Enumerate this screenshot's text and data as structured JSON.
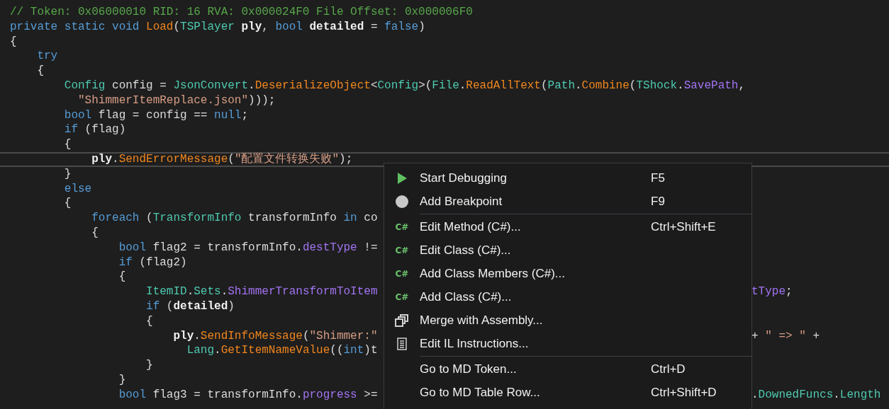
{
  "code": {
    "lines": [
      {
        "current": false,
        "tokens": [
          {
            "kind": "comment",
            "text": "// Token: 0x06000010 RID: 16 RVA: 0x000024F0 File Offset: 0x000006F0"
          }
        ]
      },
      {
        "current": false,
        "tokens": [
          {
            "kind": "keyword",
            "text": "private static void"
          },
          {
            "kind": "method",
            "text": " Load"
          },
          {
            "kind": "plain",
            "text": "("
          },
          {
            "kind": "type",
            "text": "TSPlayer"
          },
          {
            "kind": "param",
            "text": " ply"
          },
          {
            "kind": "plain",
            "text": ", "
          },
          {
            "kind": "keyword",
            "text": "bool"
          },
          {
            "kind": "param",
            "text": " detailed"
          },
          {
            "kind": "plain",
            "text": " = "
          },
          {
            "kind": "keyword",
            "text": "false"
          },
          {
            "kind": "plain",
            "text": ")"
          }
        ]
      },
      {
        "current": false,
        "tokens": [
          {
            "kind": "plain",
            "text": "{"
          }
        ]
      },
      {
        "current": false,
        "tokens": [
          {
            "kind": "keyword",
            "text": "    try"
          }
        ]
      },
      {
        "current": false,
        "tokens": [
          {
            "kind": "plain",
            "text": "    {"
          }
        ]
      },
      {
        "current": false,
        "tokens": [
          {
            "kind": "type",
            "text": "        Config"
          },
          {
            "kind": "plain",
            "text": " config = "
          },
          {
            "kind": "type",
            "text": "JsonConvert"
          },
          {
            "kind": "plain",
            "text": "."
          },
          {
            "kind": "method",
            "text": "DeserializeObject"
          },
          {
            "kind": "plain",
            "text": "<"
          },
          {
            "kind": "type",
            "text": "Config"
          },
          {
            "kind": "plain",
            "text": ">("
          },
          {
            "kind": "type",
            "text": "File"
          },
          {
            "kind": "plain",
            "text": "."
          },
          {
            "kind": "method",
            "text": "ReadAllText"
          },
          {
            "kind": "plain",
            "text": "("
          },
          {
            "kind": "type",
            "text": "Path"
          },
          {
            "kind": "plain",
            "text": "."
          },
          {
            "kind": "method",
            "text": "Combine"
          },
          {
            "kind": "plain",
            "text": "("
          },
          {
            "kind": "type",
            "text": "TShock"
          },
          {
            "kind": "plain",
            "text": "."
          },
          {
            "kind": "property",
            "text": "SavePath"
          },
          {
            "kind": "plain",
            "text": ","
          }
        ]
      },
      {
        "current": false,
        "tokens": [
          {
            "kind": "string",
            "text": "          \"ShimmerItemReplace.json\""
          },
          {
            "kind": "plain",
            "text": ")));"
          }
        ]
      },
      {
        "current": false,
        "tokens": [
          {
            "kind": "keyword",
            "text": "        bool"
          },
          {
            "kind": "plain",
            "text": " flag = config == "
          },
          {
            "kind": "keyword",
            "text": "null"
          },
          {
            "kind": "plain",
            "text": ";"
          }
        ]
      },
      {
        "current": false,
        "tokens": [
          {
            "kind": "keyword",
            "text": "        if"
          },
          {
            "kind": "plain",
            "text": " (flag)"
          }
        ]
      },
      {
        "current": false,
        "tokens": [
          {
            "kind": "plain",
            "text": "        {"
          }
        ]
      },
      {
        "current": true,
        "tokens": [
          {
            "kind": "param",
            "text": "            ply"
          },
          {
            "kind": "plain",
            "text": "."
          },
          {
            "kind": "method",
            "text": "SendErrorMessage"
          },
          {
            "kind": "plain",
            "text": "("
          },
          {
            "kind": "string",
            "text": "\"配置文件转换失败\""
          },
          {
            "kind": "plain",
            "text": ");"
          }
        ]
      },
      {
        "current": false,
        "tokens": [
          {
            "kind": "plain",
            "text": "        }"
          }
        ]
      },
      {
        "current": false,
        "tokens": [
          {
            "kind": "keyword",
            "text": "        else"
          }
        ]
      },
      {
        "current": false,
        "tokens": [
          {
            "kind": "plain",
            "text": "        {"
          }
        ]
      },
      {
        "current": false,
        "tokens": [
          {
            "kind": "keyword",
            "text": "            foreach"
          },
          {
            "kind": "plain",
            "text": " ("
          },
          {
            "kind": "type",
            "text": "TransformInfo"
          },
          {
            "kind": "plain",
            "text": " transformInfo "
          },
          {
            "kind": "keyword",
            "text": "in"
          },
          {
            "kind": "plain",
            "text": " co"
          }
        ]
      },
      {
        "current": false,
        "tokens": [
          {
            "kind": "plain",
            "text": "            {"
          }
        ]
      },
      {
        "current": false,
        "tokens": [
          {
            "kind": "keyword",
            "text": "                bool"
          },
          {
            "kind": "plain",
            "text": " flag2 = transformInfo."
          },
          {
            "kind": "property",
            "text": "destType"
          },
          {
            "kind": "plain",
            "text": " !="
          }
        ]
      },
      {
        "current": false,
        "tokens": [
          {
            "kind": "keyword",
            "text": "                if"
          },
          {
            "kind": "plain",
            "text": " (flag2)"
          }
        ]
      },
      {
        "current": false,
        "tokens": [
          {
            "kind": "plain",
            "text": "                {"
          }
        ]
      },
      {
        "current": false,
        "tokens": [
          {
            "kind": "type",
            "text": "                    ItemID"
          },
          {
            "kind": "plain",
            "text": "."
          },
          {
            "kind": "type",
            "text": "Sets"
          },
          {
            "kind": "plain",
            "text": "."
          },
          {
            "kind": "property",
            "text": "ShimmerTransformToItem"
          }
        ],
        "tail": [
          {
            "kind": "property",
            "text": "tType"
          },
          {
            "kind": "plain",
            "text": ";"
          }
        ]
      },
      {
        "current": false,
        "tokens": [
          {
            "kind": "keyword",
            "text": "                    if"
          },
          {
            "kind": "plain",
            "text": " ("
          },
          {
            "kind": "param",
            "text": "detailed"
          },
          {
            "kind": "plain",
            "text": ")"
          }
        ]
      },
      {
        "current": false,
        "tokens": [
          {
            "kind": "plain",
            "text": "                    {"
          }
        ]
      },
      {
        "current": false,
        "tokens": [
          {
            "kind": "param",
            "text": "                        ply"
          },
          {
            "kind": "plain",
            "text": "."
          },
          {
            "kind": "method",
            "text": "SendInfoMessage"
          },
          {
            "kind": "plain",
            "text": "("
          },
          {
            "kind": "string",
            "text": "\"Shimmer:\""
          }
        ],
        "tail": [
          {
            "kind": "plain",
            "text": "+ "
          },
          {
            "kind": "string",
            "text": "\" => \""
          },
          {
            "kind": "plain",
            "text": " +"
          }
        ]
      },
      {
        "current": false,
        "tokens": [
          {
            "kind": "type",
            "text": "                          Lang"
          },
          {
            "kind": "plain",
            "text": "."
          },
          {
            "kind": "method",
            "text": "GetItemNameValue"
          },
          {
            "kind": "plain",
            "text": "(("
          },
          {
            "kind": "keyword",
            "text": "int"
          },
          {
            "kind": "plain",
            "text": ")t"
          }
        ]
      },
      {
        "current": false,
        "tokens": [
          {
            "kind": "plain",
            "text": "                    }"
          }
        ]
      },
      {
        "current": false,
        "tokens": [
          {
            "kind": "plain",
            "text": "                }"
          }
        ]
      },
      {
        "current": false,
        "tokens": [
          {
            "kind": "keyword",
            "text": "                bool"
          },
          {
            "kind": "plain",
            "text": " flag3 = transformInfo."
          },
          {
            "kind": "property",
            "text": "progress"
          },
          {
            "kind": "plain",
            "text": " >="
          }
        ],
        "tail": [
          {
            "kind": "plain",
            "text": "."
          },
          {
            "kind": "type",
            "text": "DownedFuncs"
          },
          {
            "kind": "plain",
            "text": "."
          },
          {
            "kind": "type",
            "text": "Length"
          }
        ]
      }
    ]
  },
  "context_menu": {
    "groups": [
      [
        {
          "kind": "play",
          "label": "Start Debugging",
          "shortcut": "F5"
        },
        {
          "kind": "circle",
          "label": "Add Breakpoint",
          "shortcut": "F9"
        }
      ],
      [
        {
          "kind": "csharp",
          "icon_text": "C#",
          "label": "Edit Method (C#)...",
          "shortcut": "Ctrl+Shift+E"
        },
        {
          "kind": "csharp",
          "icon_text": "C#",
          "label": "Edit Class (C#)..."
        },
        {
          "kind": "csharp",
          "icon_text": "C#",
          "label": "Add Class Members (C#)..."
        },
        {
          "kind": "csharp",
          "icon_text": "C#",
          "label": "Add Class (C#)..."
        },
        {
          "kind": "copies",
          "label": "Merge with Assembly..."
        },
        {
          "kind": "document",
          "label": "Edit IL Instructions..."
        }
      ],
      [
        {
          "kind": "plain",
          "label": "Go to MD Token...",
          "shortcut": "Ctrl+D"
        },
        {
          "kind": "plain",
          "label": "Go to MD Table Row...",
          "shortcut": "Ctrl+Shift+D"
        }
      ]
    ]
  }
}
